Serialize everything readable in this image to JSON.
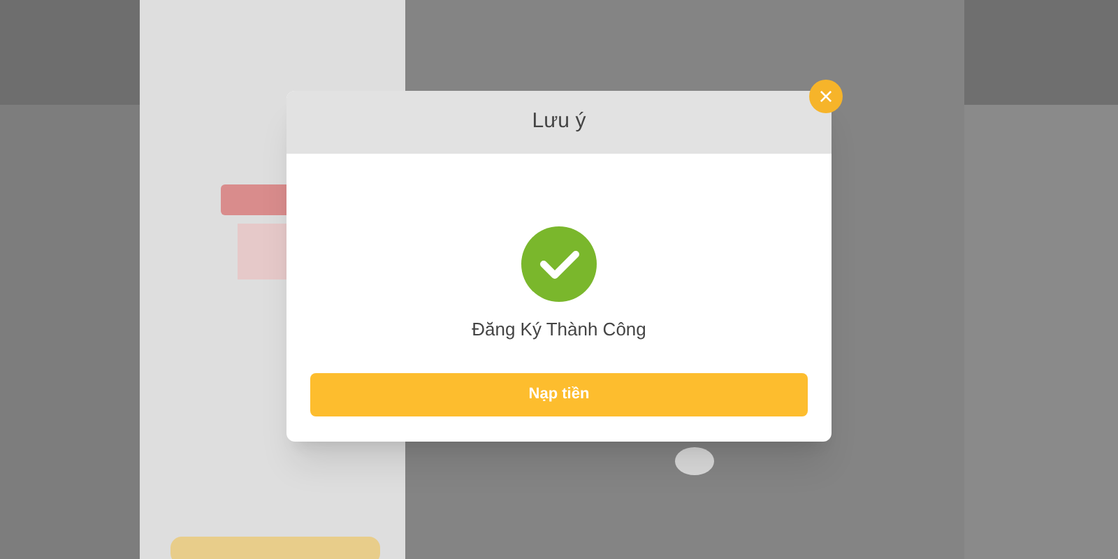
{
  "dialog": {
    "title": "Lưu ý",
    "close": "×",
    "message": "Đăng Ký Thành Công",
    "button": "Nạp tiền"
  }
}
